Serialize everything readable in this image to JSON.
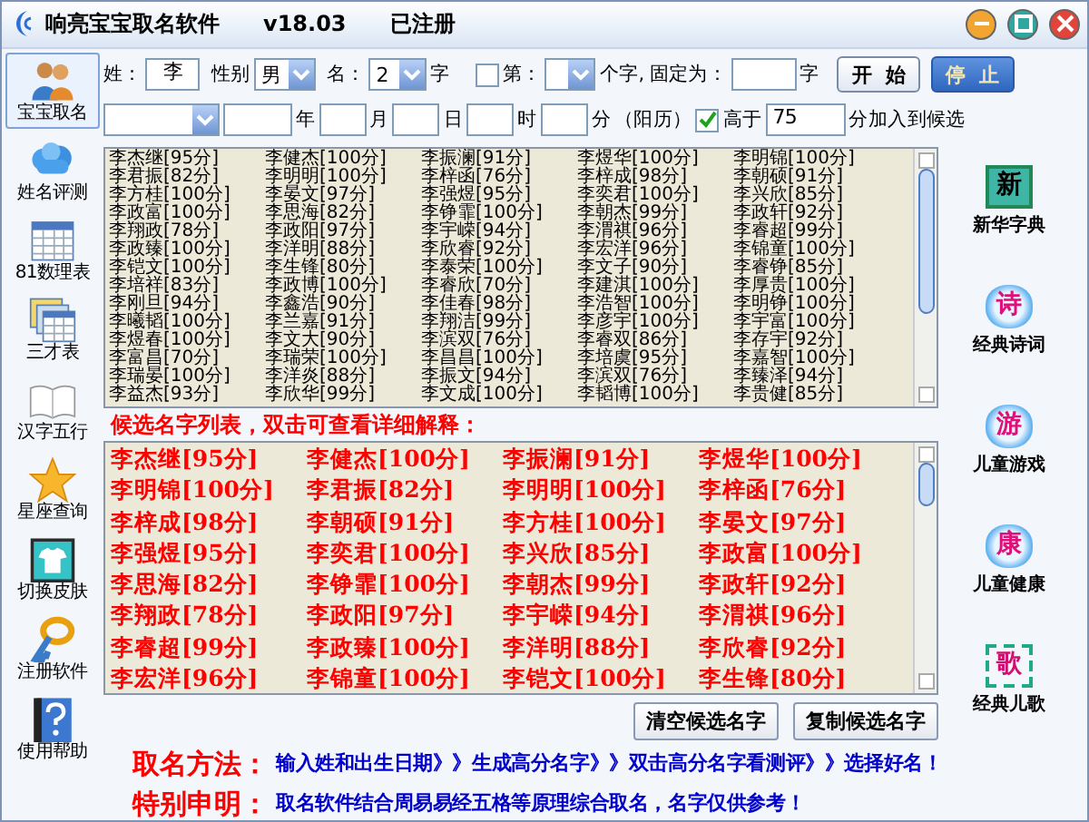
{
  "window": {
    "title": "响亮宝宝取名软件",
    "version": "v18.03",
    "status": "已注册"
  },
  "sidebar": {
    "items": [
      {
        "label": "宝宝取名",
        "selected": true
      },
      {
        "label": "姓名评测",
        "selected": false
      },
      {
        "label": "81数理表",
        "selected": false
      },
      {
        "label": "三才表",
        "selected": false
      },
      {
        "label": "汉字五行",
        "selected": false
      },
      {
        "label": "星座查询",
        "selected": false
      },
      {
        "label": "切换皮肤",
        "selected": false
      },
      {
        "label": "注册软件",
        "selected": false
      },
      {
        "label": "使用帮助",
        "selected": false
      }
    ]
  },
  "form": {
    "surname_label": "姓：",
    "surname": "李",
    "gender_label": "性别",
    "gender": "男",
    "name_label": "名：",
    "name_length": "2",
    "name_unit": "字",
    "fix_checkbox": {
      "label": "第：",
      "checked": false
    },
    "fix_label": "个字, 固定为：",
    "fix_unit": "字",
    "start_button": "开  始",
    "stop_button": {
      "label": "停  止",
      "disabled": true
    }
  },
  "birth": {
    "year_label": "年",
    "month_label": "月",
    "day_label": "日",
    "hour_label": "时",
    "minute_label": "分",
    "calendar_label": "（阳历）",
    "threshold_checkbox": {
      "label": "高于",
      "checked": true
    },
    "threshold": "75",
    "threshold_suffix": "分加入到候选"
  },
  "name_list": {
    "rows": [
      [
        "李杰继[95分]",
        "李健杰[100分]",
        "李振澜[91分]",
        "李煜华[100分]",
        "李明锦[100分]"
      ],
      [
        "李君振[82分]",
        "李明明[100分]",
        "李梓函[76分]",
        "李梓成[98分]",
        "李朝硕[91分]"
      ],
      [
        "李方桂[100分]",
        "李晏文[97分]",
        "李强煜[95分]",
        "李奕君[100分]",
        "李兴欣[85分]"
      ],
      [
        "李政富[100分]",
        "李思海[82分]",
        "李铮霏[100分]",
        "李朝杰[99分]",
        "李政轩[92分]"
      ],
      [
        "李翔政[78分]",
        "李政阳[97分]",
        "李宇嵘[94分]",
        "李渭祺[96分]",
        "李睿超[99分]"
      ],
      [
        "李政臻[100分]",
        "李洋明[88分]",
        "李欣睿[92分]",
        "李宏洋[96分]",
        "李锦童[100分]"
      ],
      [
        "李铠文[100分]",
        "李生锋[80分]",
        "李泰荣[100分]",
        "李文子[90分]",
        "李睿铮[85分]"
      ],
      [
        "李培祥[83分]",
        "李政博[100分]",
        "李睿欣[70分]",
        "李建淇[100分]",
        "李厚贵[100分]"
      ],
      [
        "李刚旦[94分]",
        "李鑫浩[90分]",
        "李佳春[98分]",
        "李浩智[100分]",
        "李明铮[100分]"
      ],
      [
        "李曦韬[100分]",
        "李兰嘉[91分]",
        "李翔洁[99分]",
        "李彦宇[100分]",
        "李宇富[100分]"
      ],
      [
        "李煜春[100分]",
        "李文大[90分]",
        "李滨双[76分]",
        "李睿双[86分]",
        "李存宇[92分]"
      ],
      [
        "李富昌[70分]",
        "李瑞荣[100分]",
        "李昌昌[100分]",
        "李培虞[95分]",
        "李嘉智[100分]"
      ],
      [
        "李瑞晏[100分]",
        "李洋炎[88分]",
        "李振文[94分]",
        "李滨双[76分]",
        "李臻泽[94分]"
      ],
      [
        "李益杰[93分]",
        "李欣华[99分]",
        "李文成[100分]",
        "李韬博[100分]",
        "李贵健[85分]"
      ]
    ]
  },
  "candidates": {
    "title": "候选名字列表，双击可查看详细解释：",
    "rows": [
      [
        "李杰继[95分]",
        "李健杰[100分]",
        "李振澜[91分]",
        "李煜华[100分]"
      ],
      [
        "李明锦[100分]",
        "李君振[82分]",
        "李明明[100分]",
        "李梓函[76分]"
      ],
      [
        "李梓成[98分]",
        "李朝硕[91分]",
        "李方桂[100分]",
        "李晏文[97分]"
      ],
      [
        "李强煜[95分]",
        "李奕君[100分]",
        "李兴欣[85分]",
        "李政富[100分]"
      ],
      [
        "李思海[82分]",
        "李铮霏[100分]",
        "李朝杰[99分]",
        "李政轩[92分]"
      ],
      [
        "李翔政[78分]",
        "李政阳[97分]",
        "李宇嵘[94分]",
        "李渭祺[96分]"
      ],
      [
        "李睿超[99分]",
        "李政臻[100分]",
        "李洋明[88分]",
        "李欣睿[92分]"
      ],
      [
        "李宏洋[96分]",
        "李锦童[100分]",
        "李铠文[100分]",
        "李生锋[80分]"
      ]
    ]
  },
  "buttons": [
    "清空候选名字",
    "复制候选名字"
  ],
  "right_sidebar": {
    "items": [
      {
        "kind": "square",
        "icon_char": "新",
        "label": "新华字典"
      },
      {
        "kind": "cloud",
        "icon_char": "诗",
        "label": "经典诗词"
      },
      {
        "kind": "cloud",
        "icon_char": "游",
        "label": "儿童游戏"
      },
      {
        "kind": "cloud",
        "icon_char": "康",
        "label": "儿童健康"
      },
      {
        "kind": "frame",
        "icon_char": "歌",
        "label": "经典儿歌"
      }
    ]
  },
  "footer": [
    {
      "label": "取名方法：",
      "text": "输入姓和出生日期》》生成高分名字》》双击高分名字看测评》》选择好名！"
    },
    {
      "label": "特别申明：",
      "text": "取名软件结合周易易经五格等原理综合取名，名字仅供参考！"
    }
  ]
}
